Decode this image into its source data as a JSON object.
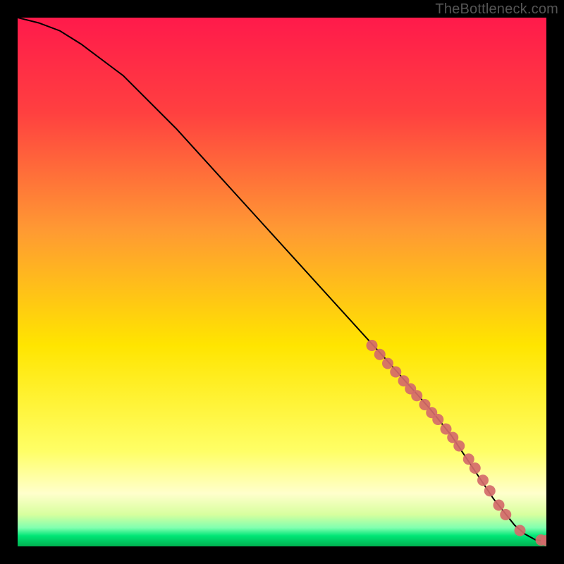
{
  "watermark": "TheBottleneck.com",
  "colors": {
    "background": "#000000",
    "curve": "#000000",
    "marker_fill": "#d46a6a",
    "marker_stroke": "#d46a6a",
    "gradient_top": "#ff1a4b",
    "gradient_upper_mid": "#ff7f2a",
    "gradient_mid": "#ffe500",
    "gradient_lower_pale": "#ffffcc",
    "gradient_green_pale": "#b6f7c1",
    "gradient_green": "#00e676",
    "gradient_green_deep": "#00b050"
  },
  "chart_data": {
    "type": "line",
    "title": "",
    "xlabel": "",
    "ylabel": "",
    "xlim": [
      0,
      100
    ],
    "ylim": [
      0,
      100
    ],
    "curve": {
      "x": [
        0,
        4,
        8,
        12,
        16,
        20,
        30,
        40,
        50,
        60,
        70,
        78,
        82,
        86,
        88,
        90,
        92,
        94,
        96,
        98,
        100
      ],
      "y": [
        100,
        99,
        97.5,
        95,
        92,
        89,
        79,
        68,
        57,
        46,
        35,
        26,
        21,
        15,
        12,
        9,
        6.5,
        4,
        2.3,
        1.2,
        1
      ]
    },
    "markers": [
      {
        "x": 67,
        "y": 38
      },
      {
        "x": 68.5,
        "y": 36.3
      },
      {
        "x": 70,
        "y": 34.6
      },
      {
        "x": 71.5,
        "y": 33
      },
      {
        "x": 73,
        "y": 31.3
      },
      {
        "x": 74.3,
        "y": 29.8
      },
      {
        "x": 75.5,
        "y": 28.5
      },
      {
        "x": 77,
        "y": 26.8
      },
      {
        "x": 78.3,
        "y": 25.3
      },
      {
        "x": 79.5,
        "y": 24
      },
      {
        "x": 81,
        "y": 22.2
      },
      {
        "x": 82.3,
        "y": 20.6
      },
      {
        "x": 83.5,
        "y": 19
      },
      {
        "x": 85.3,
        "y": 16.5
      },
      {
        "x": 86.5,
        "y": 14.8
      },
      {
        "x": 88,
        "y": 12.5
      },
      {
        "x": 89.3,
        "y": 10.5
      },
      {
        "x": 91,
        "y": 7.8
      },
      {
        "x": 92.3,
        "y": 6
      },
      {
        "x": 95,
        "y": 3
      },
      {
        "x": 99,
        "y": 1.2
      },
      {
        "x": 100,
        "y": 1.1
      }
    ]
  }
}
